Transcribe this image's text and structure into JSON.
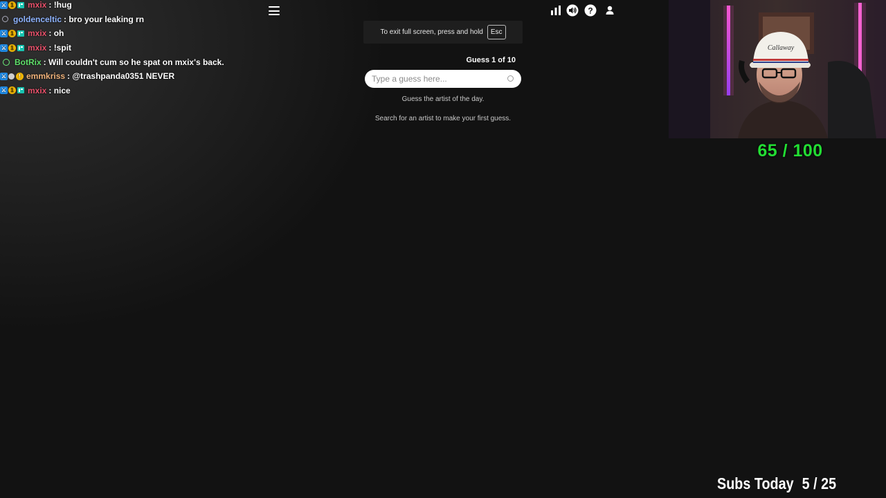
{
  "chat": [
    {
      "badges": [
        "mod",
        "sub",
        "vip"
      ],
      "user": "mxix",
      "color": "#e8506a",
      "message": ": !hug"
    },
    {
      "badges": [
        "circle"
      ],
      "user": "goldenceltic",
      "color": "#8fb4ff",
      "message": ": bro your leaking rn"
    },
    {
      "badges": [
        "mod",
        "sub",
        "vip"
      ],
      "user": "mxix",
      "color": "#e8506a",
      "message": ": oh"
    },
    {
      "badges": [
        "mod",
        "sub",
        "vip"
      ],
      "user": "mxix",
      "color": "#e8506a",
      "message": ": !spit"
    },
    {
      "badges": [
        "bot"
      ],
      "user": "BotRix",
      "color": "#5fe06a",
      "message": ": Will couldn't cum so he spat on mxix's back."
    },
    {
      "badges": [
        "mod",
        "grey",
        "gold"
      ],
      "user": "emmkriss",
      "color": "#f0b27a",
      "message": ": @trashpanda0351 NEVER"
    },
    {
      "badges": [
        "mod",
        "sub",
        "vip"
      ],
      "user": "mxix",
      "color": "#e8506a",
      "message": ": nice"
    }
  ],
  "toast": {
    "text": "To exit full screen, press and hold",
    "key": "Esc"
  },
  "game": {
    "guess_counter": "Guess 1 of 10",
    "search_placeholder": "Type a guess here...",
    "hint_primary": "Guess the artist of the day.",
    "hint_secondary": "Search for an artist to make your first guess."
  },
  "icons": [
    "stats-icon",
    "sound-icon",
    "help-icon",
    "profile-icon"
  ],
  "overlay": {
    "score": "65 / 100",
    "subs_label": "Subs Today",
    "subs_value": "5 / 25"
  },
  "colors": {
    "accent_green": "#22dd33",
    "background": "#121212"
  }
}
